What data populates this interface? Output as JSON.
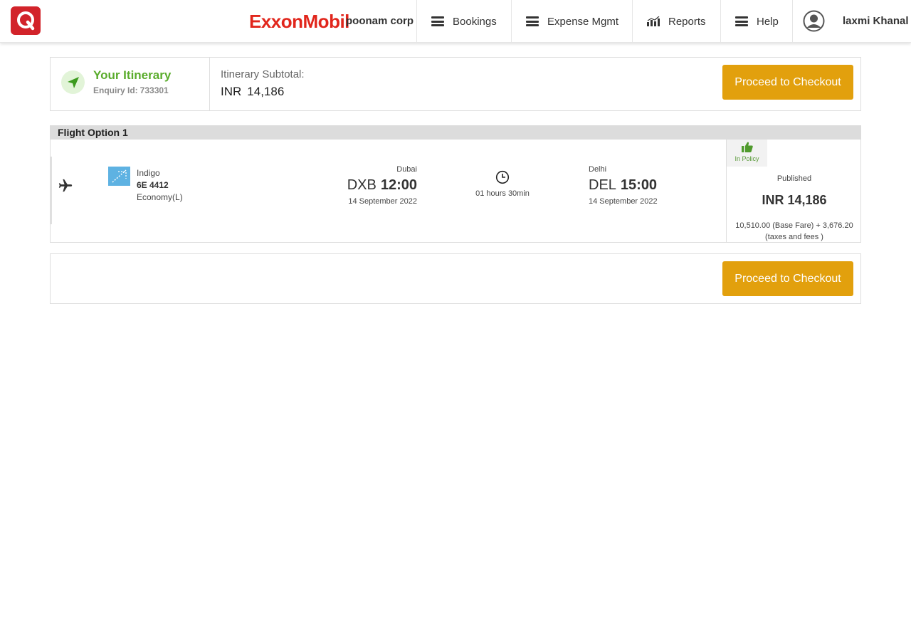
{
  "header": {
    "brand": "ExxonMobil",
    "corp": "poonam corp",
    "nav": [
      {
        "label": "Bookings",
        "icon": "menu-icon"
      },
      {
        "label": "Expense Mgmt",
        "icon": "menu-icon"
      },
      {
        "label": "Reports",
        "icon": "bar-chart-icon"
      },
      {
        "label": "Help",
        "icon": "menu-icon"
      }
    ],
    "user": "laxmi Khanal"
  },
  "itinerary": {
    "title": "Your Itinerary",
    "enquiry_label": "Enquiry Id:",
    "enquiry_id": "733301",
    "subtotal_label": "Itinerary Subtotal:",
    "subtotal_currency": "INR",
    "subtotal_amount": "14,186",
    "checkout_label": "Proceed to Checkout"
  },
  "flight_option": {
    "title": "Flight Option 1",
    "airline": "Indigo",
    "flight_no": "6E 4412",
    "cabin": "Economy(L)",
    "departure": {
      "city": "Dubai",
      "code": "DXB",
      "time": "12:00",
      "date": "14 September 2022"
    },
    "duration": "01 hours 30min",
    "arrival": {
      "city": "Delhi",
      "code": "DEL",
      "time": "15:00",
      "date": "14 September 2022"
    },
    "policy": "In Policy",
    "fare_type": "Published",
    "price_currency": "INR",
    "price_amount": "14,186",
    "fare_breakdown_line1": "10,510.00 (Base Fare) + 3,676.20",
    "fare_breakdown_line2": "(taxes and fees )"
  },
  "footer": {
    "checkout_label": "Proceed to Checkout"
  },
  "colors": {
    "accent": "#e2a00d",
    "brand_red": "#e1261c",
    "itinerary_green": "#5aac2c"
  }
}
